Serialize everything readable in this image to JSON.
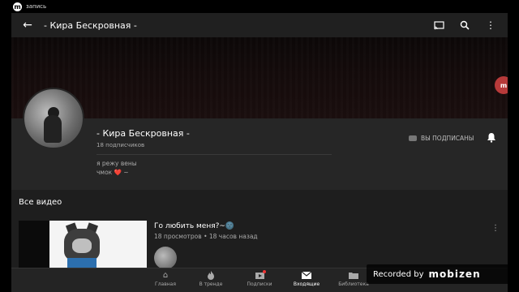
{
  "status_bar": {
    "recorder_badge": "m",
    "text": "запись"
  },
  "app_bar": {
    "title": "- Кира Бескровная -",
    "icons": [
      "back-arrow-icon",
      "cast-icon",
      "search-icon",
      "more-vert-icon"
    ]
  },
  "channel": {
    "name": "- Кира Бескровная -",
    "subscribers": "18 подписчиков",
    "subscribed_label": "ВЫ ПОДПИСАНЫ",
    "description_line1": "я режу вены",
    "description_line2": "чмок ❤️ ~"
  },
  "side_badge": "m",
  "videos_section": {
    "title": "Все видео",
    "items": [
      {
        "title": "Го любить меня?~🌚",
        "meta": "18 просмотров • 18 часов назад"
      }
    ]
  },
  "bottom_nav": {
    "items": [
      {
        "label": "Главная",
        "icon": "home-icon"
      },
      {
        "label": "В тренде",
        "icon": "fire-icon"
      },
      {
        "label": "Подписки",
        "icon": "subscriptions-icon"
      },
      {
        "label": "Входящие",
        "icon": "inbox-icon",
        "active": true
      },
      {
        "label": "Библиотека",
        "icon": "library-folder-icon"
      }
    ]
  },
  "recorder": {
    "label": "Recorded by",
    "brand": "mobizen"
  },
  "colors": {
    "background": "#1e1e1e",
    "accent_red": "#e33333"
  }
}
